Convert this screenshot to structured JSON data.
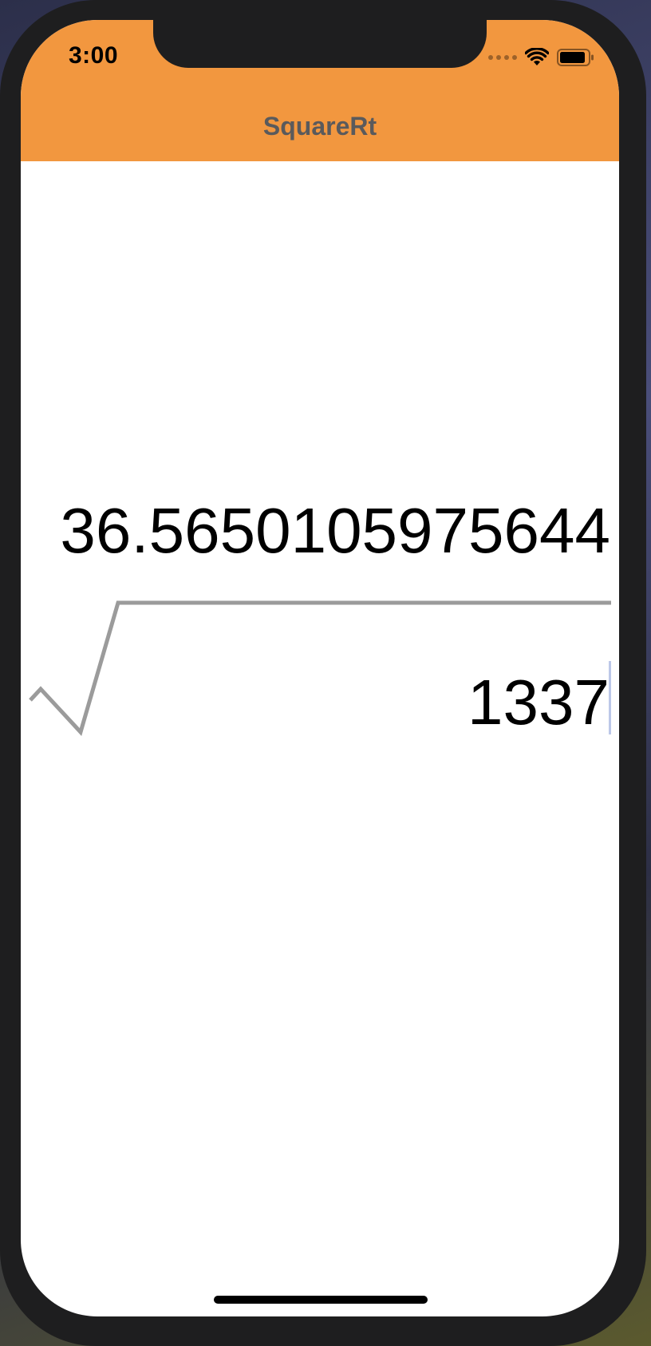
{
  "status_bar": {
    "time": "3:00"
  },
  "navbar": {
    "title": "SquareRt",
    "background_color": "#F2973F"
  },
  "calculator": {
    "result": "36.5650105975644",
    "input_value": "1337"
  },
  "colors": {
    "radical_stroke": "#9B9B9B",
    "text": "#000000"
  }
}
